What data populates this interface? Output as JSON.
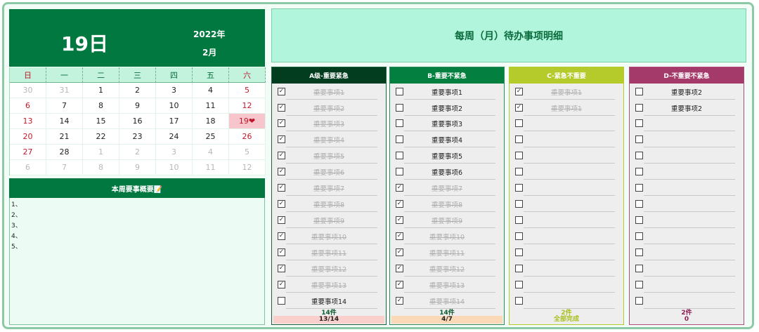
{
  "calendar": {
    "day": "19日",
    "year": "2022年",
    "month": "2月",
    "weekdays": [
      "日",
      "一",
      "二",
      "三",
      "四",
      "五",
      "六"
    ],
    "weeks": [
      [
        {
          "d": "30",
          "t": "other"
        },
        {
          "d": "31",
          "t": "other"
        },
        {
          "d": "1"
        },
        {
          "d": "2"
        },
        {
          "d": "3"
        },
        {
          "d": "4"
        },
        {
          "d": "5",
          "t": "red"
        }
      ],
      [
        {
          "d": "6",
          "t": "red"
        },
        {
          "d": "7"
        },
        {
          "d": "8"
        },
        {
          "d": "9"
        },
        {
          "d": "10"
        },
        {
          "d": "11"
        },
        {
          "d": "12",
          "t": "red"
        }
      ],
      [
        {
          "d": "13",
          "t": "red"
        },
        {
          "d": "14"
        },
        {
          "d": "15"
        },
        {
          "d": "16"
        },
        {
          "d": "17"
        },
        {
          "d": "18"
        },
        {
          "d": "19❤",
          "t": "today"
        }
      ],
      [
        {
          "d": "20",
          "t": "red"
        },
        {
          "d": "21"
        },
        {
          "d": "22"
        },
        {
          "d": "23"
        },
        {
          "d": "24"
        },
        {
          "d": "25"
        },
        {
          "d": "26",
          "t": "red"
        }
      ],
      [
        {
          "d": "27",
          "t": "red"
        },
        {
          "d": "28"
        },
        {
          "d": "1",
          "t": "other"
        },
        {
          "d": "2",
          "t": "other"
        },
        {
          "d": "3",
          "t": "other"
        },
        {
          "d": "4",
          "t": "other"
        },
        {
          "d": "5",
          "t": "other"
        }
      ],
      [
        {
          "d": "6",
          "t": "other"
        },
        {
          "d": "7",
          "t": "other"
        },
        {
          "d": "8",
          "t": "other"
        },
        {
          "d": "9",
          "t": "other"
        },
        {
          "d": "10",
          "t": "other"
        },
        {
          "d": "11",
          "t": "other"
        },
        {
          "d": "12",
          "t": "other"
        }
      ]
    ]
  },
  "summary": {
    "title": "本周要事概要📝",
    "lines": [
      "1、",
      "2、",
      "3、",
      "4、",
      "5、"
    ]
  },
  "main_title": "每周（月）待办事项明细",
  "columns": [
    {
      "title": "A级-重要紧急",
      "head_color": "#023d1f",
      "border_color": "#1f5f3d",
      "count": "14件",
      "count_color": "#0f5b32",
      "status": "13/14",
      "status_bg": "#f9d0cc",
      "status_color": "#222222",
      "tasks": [
        {
          "label": "重要事项1",
          "done": true
        },
        {
          "label": "重要事项2",
          "done": true
        },
        {
          "label": "重要事项3",
          "done": true
        },
        {
          "label": "重要事项4",
          "done": true
        },
        {
          "label": "重要事项5",
          "done": true
        },
        {
          "label": "重要事项6",
          "done": true
        },
        {
          "label": "重要事项7",
          "done": true
        },
        {
          "label": "重要事项8",
          "done": true
        },
        {
          "label": "重要事项9",
          "done": true
        },
        {
          "label": "重要事项10",
          "done": true
        },
        {
          "label": "重要事项11",
          "done": true
        },
        {
          "label": "重要事项12",
          "done": true
        },
        {
          "label": "重要事项13",
          "done": true
        },
        {
          "label": "重要事项14",
          "done": false
        }
      ]
    },
    {
      "title": "B-重要不紧急",
      "head_color": "#03803f",
      "border_color": "#2f8a5a",
      "count": "14件",
      "count_color": "#0f5b32",
      "status": "4/7",
      "status_bg": "#fbd9b6",
      "status_color": "#222222",
      "tasks": [
        {
          "label": "重要事项1",
          "done": false
        },
        {
          "label": "重要事项2",
          "done": false
        },
        {
          "label": "重要事项3",
          "done": false
        },
        {
          "label": "重要事项4",
          "done": false
        },
        {
          "label": "重要事项5",
          "done": false
        },
        {
          "label": "重要事项6",
          "done": false
        },
        {
          "label": "重要事项7",
          "done": true
        },
        {
          "label": "重要事项8",
          "done": true
        },
        {
          "label": "重要事项9",
          "done": true
        },
        {
          "label": "重要事项10",
          "done": true
        },
        {
          "label": "重要事项11",
          "done": true
        },
        {
          "label": "重要事项12",
          "done": true
        },
        {
          "label": "重要事项13",
          "done": true
        },
        {
          "label": "重要事项14",
          "done": true
        }
      ]
    },
    {
      "title": "C-紧急不重要",
      "head_color": "#b5ca2b",
      "border_color": "#b5ca2b",
      "count": "2件",
      "count_color": "#a9bf1e",
      "status": "全部完成",
      "status_bg": "transparent",
      "status_color": "#a9bf1e",
      "tasks": [
        {
          "label": "重要事项1",
          "done": true
        },
        {
          "label": "重要事项1",
          "done": true
        },
        {
          "label": "",
          "done": false
        },
        {
          "label": "",
          "done": false
        },
        {
          "label": "",
          "done": false
        },
        {
          "label": "",
          "done": false
        },
        {
          "label": "",
          "done": false
        },
        {
          "label": "",
          "done": false
        },
        {
          "label": "",
          "done": false
        },
        {
          "label": "",
          "done": false
        },
        {
          "label": "",
          "done": false
        },
        {
          "label": "",
          "done": false
        },
        {
          "label": "",
          "done": false
        },
        {
          "label": "",
          "done": false
        }
      ]
    },
    {
      "title": "D-不重要不紧急",
      "head_color": "#a43a6a",
      "border_color": "#b44a7a",
      "count": "2件",
      "count_color": "#8f1f52",
      "status": "0",
      "status_bg": "transparent",
      "status_color": "#8f1f52",
      "tasks": [
        {
          "label": "重要事项2",
          "done": false
        },
        {
          "label": "重要事项2",
          "done": false
        },
        {
          "label": "",
          "done": false
        },
        {
          "label": "",
          "done": false
        },
        {
          "label": "",
          "done": false
        },
        {
          "label": "",
          "done": false
        },
        {
          "label": "",
          "done": false
        },
        {
          "label": "",
          "done": false
        },
        {
          "label": "",
          "done": false
        },
        {
          "label": "",
          "done": false
        },
        {
          "label": "",
          "done": false
        },
        {
          "label": "",
          "done": false
        },
        {
          "label": "",
          "done": false
        },
        {
          "label": "",
          "done": false
        }
      ]
    }
  ]
}
